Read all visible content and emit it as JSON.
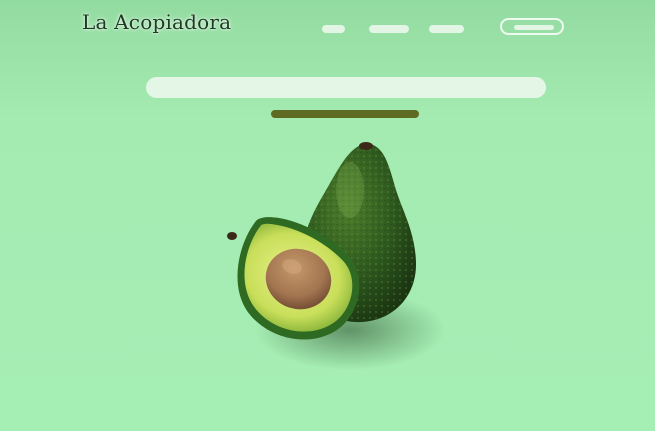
{
  "brand": {
    "name": "La Acopiadora"
  },
  "colors": {
    "background": "#a4ebb2",
    "nav_pill": "#e3f6e6",
    "search_bar": "#e4f7e7",
    "cta_bar": "#5f6a22",
    "avocado_skin": "#2f5a1f",
    "avocado_flesh": "#d9e86a",
    "avocado_seed": "#a97a55"
  },
  "nav": {
    "items": [
      "",
      "",
      ""
    ],
    "button_label": ""
  },
  "search": {
    "placeholder": ""
  },
  "cta": {
    "label": ""
  },
  "hero": {
    "image": "avocado-image"
  }
}
